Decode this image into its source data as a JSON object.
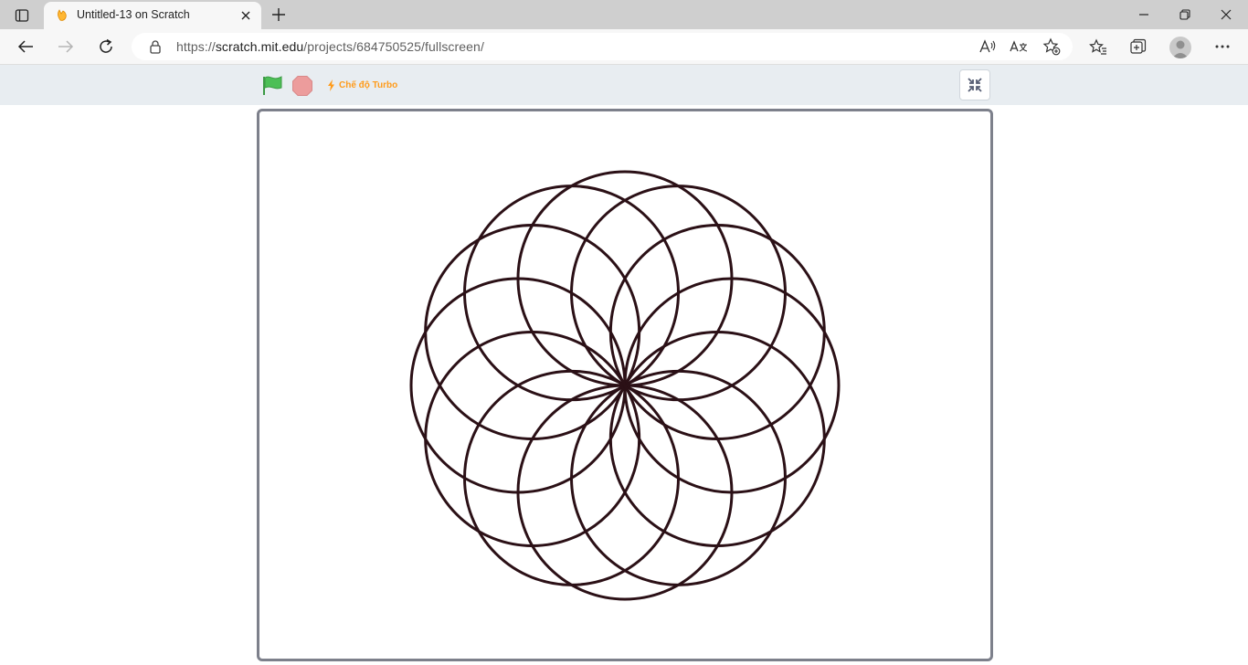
{
  "browser": {
    "tab": {
      "title": "Untitled-13 on Scratch",
      "favicon": "scratch-cat-icon"
    },
    "address": {
      "url_prefix": "https://",
      "url_host": "scratch.mit.edu",
      "url_path": "/projects/684750525/fullscreen/"
    }
  },
  "scratch": {
    "turbo_label": "Chế độ Turbo"
  },
  "colors": {
    "flag": "#4cbf56",
    "stop": "#ec9c9c",
    "turbo": "#ff9b1a",
    "pen": "#2b1016",
    "stage_border": "#7d808b"
  },
  "drawing": {
    "circle_count": 12,
    "description_shape": "rosette"
  }
}
